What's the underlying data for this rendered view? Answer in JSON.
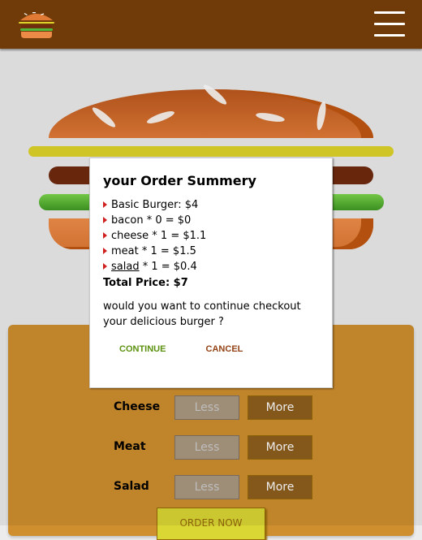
{
  "toolbar": {
    "logo": "burger-logo-icon",
    "menu": "hamburger-menu-icon"
  },
  "colors": {
    "toolbar_bg": "#703b09",
    "controls_bg": "#cf8f2e",
    "more_button": "#8f5e1e",
    "less_button": "#ac9980",
    "order_button": "#dad735",
    "continue_text": "#5c9210",
    "cancel_text": "#944317",
    "bullet": "#d01f1f"
  },
  "burger": {
    "ingredients": [
      "cheese",
      "meat",
      "salad"
    ]
  },
  "controls": [
    {
      "label": "Cheese",
      "less": "Less",
      "more": "More"
    },
    {
      "label": "Meat",
      "less": "Less",
      "more": "More"
    },
    {
      "label": "Salad",
      "less": "Less",
      "more": "More"
    }
  ],
  "order_button": "ORDER NOW",
  "modal": {
    "title": "your Order Summery",
    "items": [
      "Basic Burger: $4",
      "bacon * 0 = $0",
      "cheese * 1 = $1.1",
      "meat * 1 = $1.5",
      "salad",
      " * 1 = $0.4"
    ],
    "total": "Total Price: $7",
    "question": "would you want to continue checkout your delicious burger ?",
    "continue": "CONTINUE",
    "cancel": "CANCEL"
  }
}
